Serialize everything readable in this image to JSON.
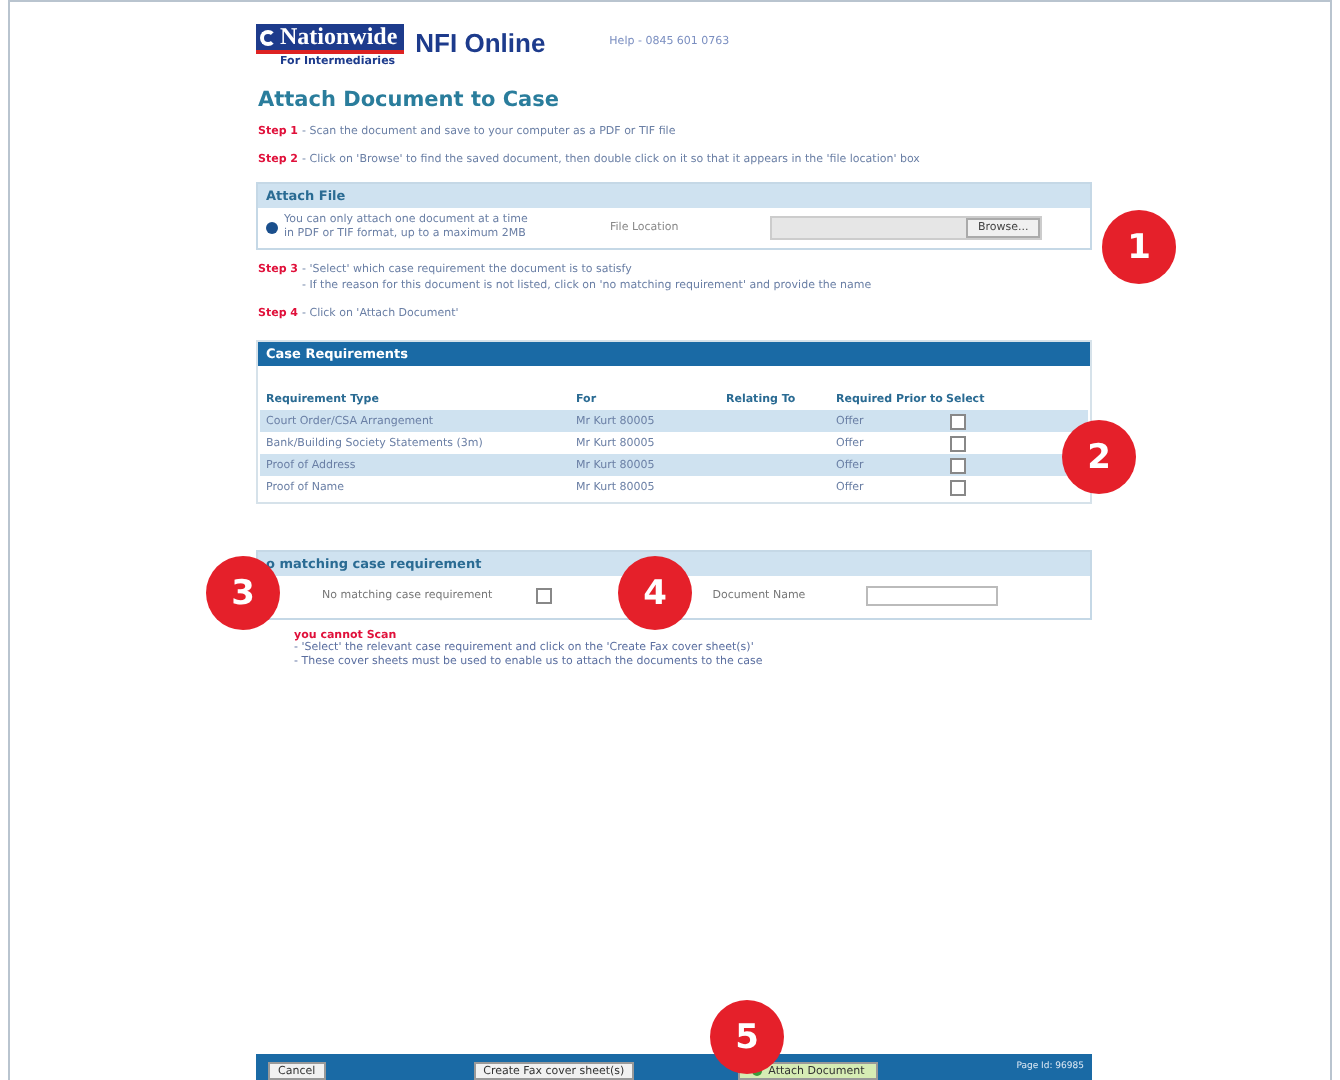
{
  "header": {
    "brand": "Nationwide",
    "brand_sub": "For Intermediaries",
    "product": "NFI Online",
    "help": "Help - 0845 601 0763"
  },
  "title": "Attach Document to Case",
  "steps_top": [
    {
      "label": "Step 1",
      "lines": [
        "- Scan the document and save to your computer as a PDF or TIF file"
      ]
    },
    {
      "label": "Step 2",
      "lines": [
        "- Click on 'Browse' to find the saved document, then double click on it so that it appears in the 'file location' box"
      ]
    }
  ],
  "attach_file": {
    "title": "Attach File",
    "info": "You can only attach one document at a time in PDF or TIF format, up to a maximum 2MB",
    "field_label": "File Location",
    "browse": "Browse..."
  },
  "steps_mid": [
    {
      "label": "Step 3",
      "lines": [
        "- 'Select' which case requirement the document is to satisfy",
        "- If the reason for this document is not listed, click on 'no matching requirement' and provide the name"
      ]
    },
    {
      "label": "Step 4",
      "lines": [
        "- Click on 'Attach Document'"
      ]
    }
  ],
  "case_requirements": {
    "title": "Case Requirements",
    "columns": [
      "Requirement Type",
      "For",
      "Relating To",
      "Required Prior to",
      "Select"
    ],
    "rows": [
      {
        "type": "Court Order/CSA Arrangement",
        "for": "Mr Kurt 80005",
        "prior_to": "Offer",
        "checked": false
      },
      {
        "type": "Bank/Building Society Statements (3m)",
        "for": "Mr Kurt 80005",
        "prior_to": "Offer",
        "checked": false
      },
      {
        "type": "Proof of Address",
        "for": "Mr Kurt 80005",
        "prior_to": "Offer",
        "checked": false
      },
      {
        "type": "Proof of Name",
        "for": "Mr Kurt 80005",
        "prior_to": "Offer",
        "checked": false
      }
    ]
  },
  "no_match": {
    "title": "o matching case requirement",
    "checkbox_label": "No matching case requirement",
    "checked": false,
    "name_label": "Document Name"
  },
  "cannot_scan": {
    "title": "you cannot Scan",
    "lines": [
      "- 'Select' the relevant case requirement and click on the 'Create Fax cover sheet(s)'",
      "- These cover sheets must be used to enable us to attach the documents to the case"
    ]
  },
  "footer": {
    "cancel": "Cancel",
    "fax": "Create Fax cover sheet(s)",
    "attach": "Attach Document",
    "page_id": "Page Id: 96985"
  },
  "callouts": [
    "1",
    "2",
    "3",
    "4",
    "5"
  ]
}
